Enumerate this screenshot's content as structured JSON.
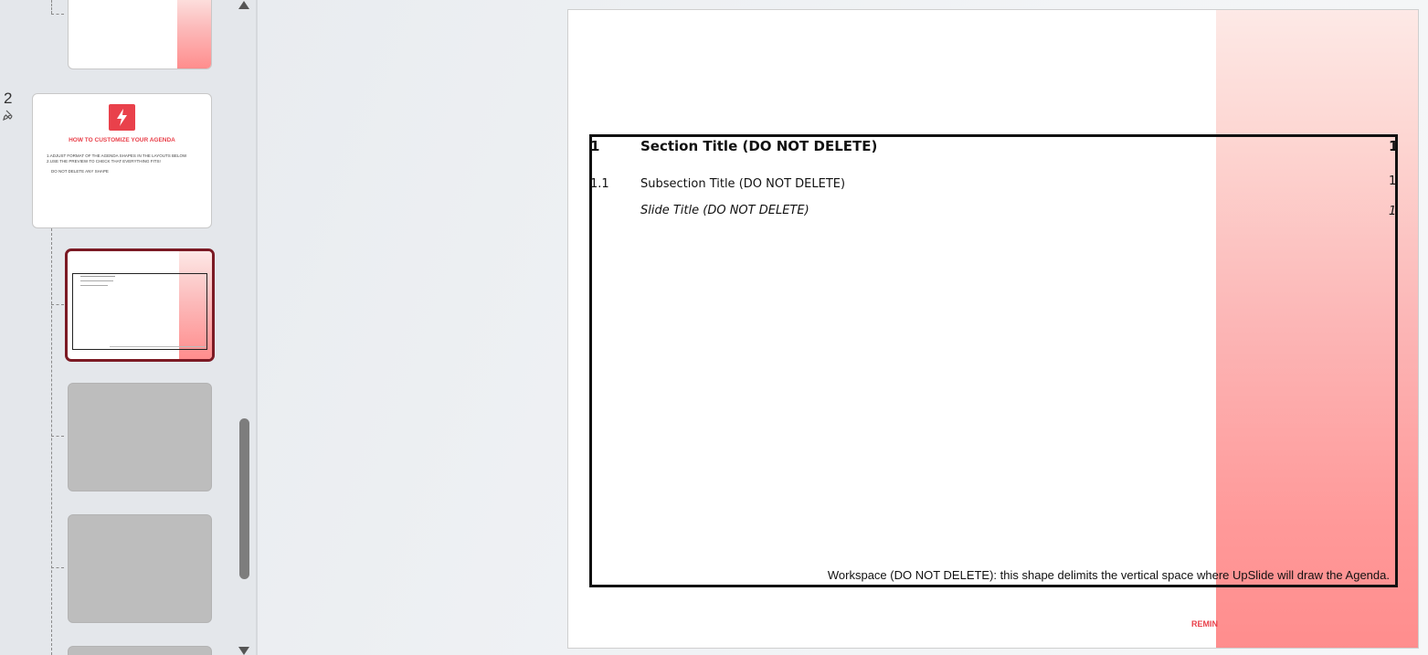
{
  "thumbnails": {
    "slide_number": "2",
    "agenda_thumb": {
      "title": "HOW TO CUSTOMIZE YOUR AGENDA",
      "line1": "1.ADJUST FORMAT OF THE AGENDA SHAPES IN THE LAYOUTS BELOW",
      "line2": "2.USE THE PREVIEW TO CHECK THAT EVERYTHING FITS!",
      "line3": "DO NOT DELETE ANY SHAPE",
      "logo_color": "#e9414b"
    }
  },
  "slide": {
    "section_number": "1",
    "section_title": "Section Title (DO NOT DELETE)",
    "section_page": "1",
    "subsection_number": "1.1",
    "subsection_title": "Subsection Title (DO NOT DELETE)",
    "subsection_page": "1",
    "slide_title": "Slide Title (DO NOT DELETE)",
    "slide_page": "1",
    "workspace_note": "Workspace (DO NOT DELETE): this shape delimits the vertical space where UpSlide will draw the Agenda.",
    "reminder_fragment": "REMIN"
  },
  "colors": {
    "accent_red": "#e9414b",
    "selected_border": "#7b1a24"
  }
}
